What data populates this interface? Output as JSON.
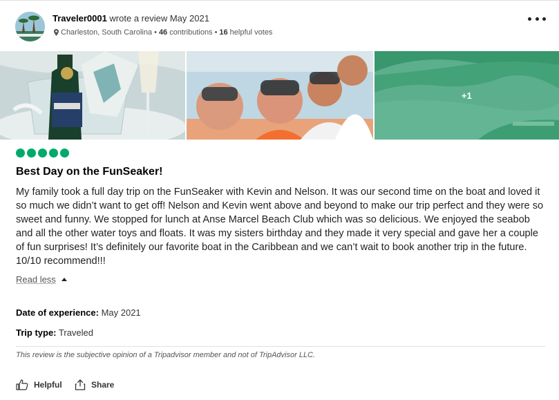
{
  "review": {
    "username": "Traveler0001",
    "action_text": "wrote a review May 2021",
    "location": "Charleston, South Carolina",
    "contributions_count": "46",
    "contributions_label": "contributions",
    "helpful_votes_count": "16",
    "helpful_votes_label": "helpful votes",
    "more_photos_label": "+1",
    "rating_bubbles": 5,
    "title": "Best Day on the FunSeaker!",
    "body": "My family took a full day trip on the FunSeaker with Kevin and Nelson. It was our second time on the boat and loved it so much we didn’t want to get off! Nelson and Kevin went above and beyond to make our trip perfect and they were so sweet and funny. We stopped for lunch at Anse Marcel Beach Club which was so delicious. We enjoyed the seabob and all the other water toys and floats. It was my sisters birthday and they made it very special and gave her a couple of fun surprises! It’s definitely our favorite boat in the Caribbean and we can’t wait to book another trip in the future. 10/10 recommend!!!",
    "read_less_label": "Read less",
    "date_of_experience_label": "Date of experience:",
    "date_of_experience_value": "May 2021",
    "trip_type_label": "Trip type:",
    "trip_type_value": "Traveled",
    "disclaimer": "This review is the subjective opinion of a Tripadvisor member and not of TripAdvisor LLC.",
    "helpful_label": "Helpful",
    "share_label": "Share"
  },
  "colors": {
    "rating_green": "#00aa6c",
    "photo_overlay": "#3fa37a"
  },
  "icons": [
    "avatar",
    "more-dots-icon",
    "location-pin-icon",
    "caret-up-icon",
    "thumbs-up-icon",
    "share-icon"
  ]
}
